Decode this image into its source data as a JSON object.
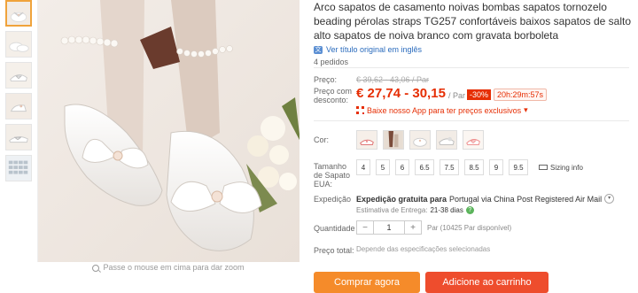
{
  "thumbnails": [
    {
      "name": "thumb-1",
      "active": true
    },
    {
      "name": "thumb-2",
      "active": false
    },
    {
      "name": "thumb-3",
      "active": false
    },
    {
      "name": "thumb-4",
      "active": false
    },
    {
      "name": "thumb-5",
      "active": false
    },
    {
      "name": "thumb-6",
      "active": false
    }
  ],
  "zoom_hint": "Passe o mouse em cima para dar zoom",
  "product": {
    "title": "Arco sapatos de casamento noivas bombas sapatos tornozelo beading pérolas straps TG257 confortáveis baixos sapatos de salto alto sapatos de noiva branco com gravata borboleta",
    "translate_link": "Ver título original em inglês",
    "translate_icon": "translate-icon",
    "orders": "4 pedidos"
  },
  "price": {
    "label": "Preço:",
    "old_value": "€ 39,62 - 43,06 / Par",
    "discount_label": "Preço com desconto:",
    "value": "€ 27,74 - 30,15",
    "per_unit": "/ Par",
    "discount_badge": "-30%",
    "countdown": "20h:29m:57s",
    "app_promo": "Baixe nosso App para ter preços exclusivos",
    "app_promo_caret": "▾"
  },
  "color": {
    "label": "Cor:",
    "options": [
      "color-option-1",
      "color-option-2",
      "color-option-3",
      "color-option-4",
      "color-option-5"
    ]
  },
  "size": {
    "label": "Tamanho de Sapato EUA:",
    "options": [
      "4",
      "5",
      "6",
      "6.5",
      "7.5",
      "8.5",
      "9",
      "9.5"
    ],
    "sizing_info": "Sizing info"
  },
  "shipping": {
    "label": "Expedição",
    "prefix": "Expedição gratuita para",
    "details": "Portugal via China Post Registered Air Mail",
    "eta_label": "Estimativa de Entrega:",
    "eta_value": "21-38 dias"
  },
  "quantity": {
    "label": "Quantidade",
    "minus": "−",
    "value": "1",
    "plus": "+",
    "available": "Par (10425 Par disponível)"
  },
  "total": {
    "label": "Preço total:",
    "value": "Depende das especificações selecionadas"
  },
  "actions": {
    "buy_now": "Comprar agora",
    "add_to_cart": "Adicione ao carrinho"
  },
  "colors": {
    "price_red": "#e62e04",
    "buy_orange": "#f58b2a",
    "cart_red": "#ee4d2d",
    "link_blue": "#2a6bbd"
  }
}
